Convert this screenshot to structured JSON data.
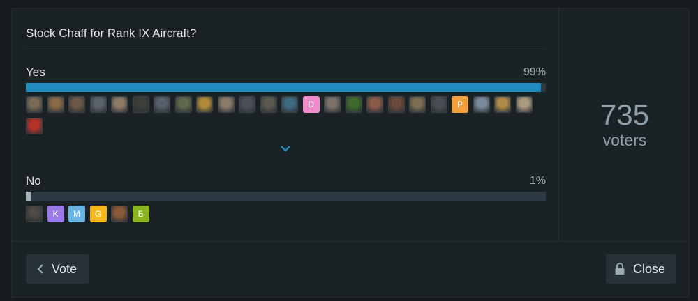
{
  "poll": {
    "question": "Stock Chaff for Rank IX Aircraft?",
    "options": [
      {
        "label": "Yes",
        "percent_text": "99%",
        "percent": 99,
        "avatars": [
          {
            "type": "photo",
            "color": "#7a6a58"
          },
          {
            "type": "photo",
            "color": "#8a6a48"
          },
          {
            "type": "photo",
            "color": "#6b5848"
          },
          {
            "type": "photo",
            "color": "#5a626a"
          },
          {
            "type": "photo",
            "color": "#8c7a66"
          },
          {
            "type": "photo",
            "color": "#3c4038"
          },
          {
            "type": "photo",
            "color": "#56606a"
          },
          {
            "type": "photo",
            "color": "#5e6a4e"
          },
          {
            "type": "photo",
            "color": "#b08a3a"
          },
          {
            "type": "photo",
            "color": "#8a7a6a"
          },
          {
            "type": "photo",
            "color": "#4a5058"
          },
          {
            "type": "photo",
            "color": "#5c5a4e"
          },
          {
            "type": "photo",
            "color": "#3e6a80"
          },
          {
            "type": "letter",
            "letter": "D",
            "color": "#ee8ccc"
          },
          {
            "type": "photo",
            "color": "#7a7268"
          },
          {
            "type": "photo",
            "color": "#3e6a2e"
          },
          {
            "type": "photo",
            "color": "#8a5a48"
          },
          {
            "type": "photo",
            "color": "#6a4a3a"
          },
          {
            "type": "photo",
            "color": "#7e6e52"
          },
          {
            "type": "photo",
            "color": "#4a4e54"
          },
          {
            "type": "letter",
            "letter": "P",
            "color": "#f2a23c"
          },
          {
            "type": "photo",
            "color": "#7a8a9a"
          },
          {
            "type": "photo",
            "color": "#b08a4a"
          },
          {
            "type": "photo",
            "color": "#aa9a80"
          },
          {
            "type": "photo",
            "color": "#b4322a"
          }
        ]
      },
      {
        "label": "No",
        "percent_text": "1%",
        "percent": 1,
        "avatars": [
          {
            "type": "photo",
            "color": "#4e4a44"
          },
          {
            "type": "letter",
            "letter": "K",
            "color": "#9a7ae6"
          },
          {
            "type": "letter",
            "letter": "M",
            "color": "#6ab4e0"
          },
          {
            "type": "letter",
            "letter": "G",
            "color": "#f2b81c"
          },
          {
            "type": "photo",
            "color": "#8a5a3a"
          },
          {
            "type": "letter",
            "letter": "Б",
            "color": "#8ab420"
          }
        ]
      }
    ],
    "voter_count": "735",
    "voter_label": "voters",
    "expand_icon": "chevron-down-icon"
  },
  "footer": {
    "vote_label": "Vote",
    "close_label": "Close",
    "vote_icon": "chevron-left-icon",
    "close_icon": "lock-icon"
  },
  "colors": {
    "background": "#1b2226",
    "bar_fill": "#1f8cc0",
    "bar_track": "#2c3a44",
    "button": "#263138",
    "muted_text": "#8fa0aa"
  }
}
